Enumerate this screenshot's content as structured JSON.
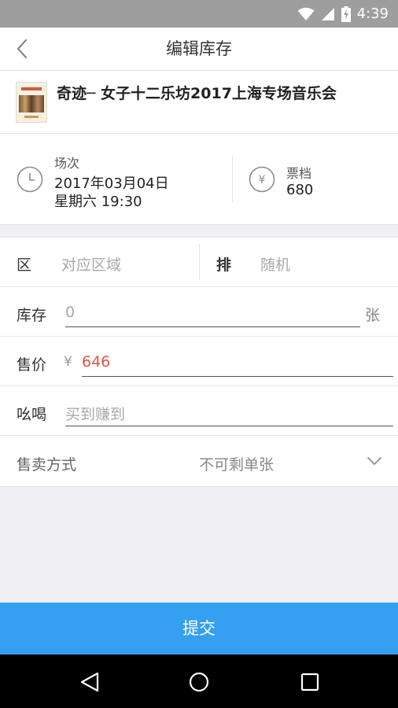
{
  "status_bar": {
    "time": "4:39"
  },
  "header": {
    "title": "编辑库存"
  },
  "event": {
    "name": "奇迹─ 女子十二乐坊2017上海专场音乐会"
  },
  "session": {
    "label": "场次",
    "date": "2017年03月04日",
    "weekday_time": "星期六 19:30",
    "tier_label": "票档",
    "tier_value": "680",
    "yen_symbol": "¥"
  },
  "form": {
    "zone_label": "区",
    "zone_placeholder": "对应区域",
    "row_label": "排",
    "row_placeholder": "随机",
    "stock_label": "库存",
    "stock_placeholder": "0",
    "stock_unit": "张",
    "price_label": "售价",
    "price_currency": "¥",
    "price_value": "646",
    "slogan_label": "吆喝",
    "slogan_placeholder": "买到赚到",
    "sale_mode_label": "售卖方式",
    "sale_mode_value": "不可剩单张"
  },
  "submit_label": "提交",
  "colors": {
    "accent": "#35a0f0",
    "price": "#e0533f"
  }
}
